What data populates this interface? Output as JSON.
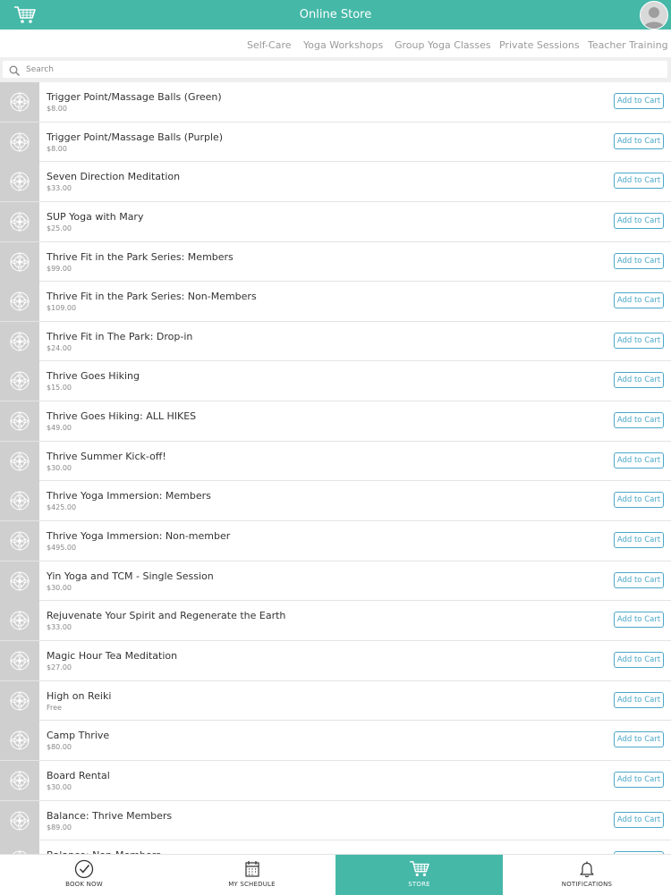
{
  "header": {
    "title": "Online Store"
  },
  "tabs": [
    "Self-Care",
    "Yoga Workshops",
    "Group Yoga Classes",
    "Private Sessions",
    "Teacher Training P"
  ],
  "search": {
    "placeholder": "Search"
  },
  "items": [
    {
      "name": "Trigger Point/Massage Balls (Green)",
      "price": "$8.00",
      "action": "Add to Cart"
    },
    {
      "name": "Trigger Point/Massage Balls (Purple)",
      "price": "$8.00",
      "action": "Add to Cart"
    },
    {
      "name": "Seven Direction Meditation",
      "price": "$33.00",
      "action": "Add to Cart"
    },
    {
      "name": "SUP Yoga with Mary",
      "price": "$25.00",
      "action": "Add to Cart"
    },
    {
      "name": "Thrive Fit in the Park Series: Members",
      "price": "$99.00",
      "action": "Add to Cart"
    },
    {
      "name": "Thrive Fit in the Park Series: Non-Members",
      "price": "$109.00",
      "action": "Add to Cart"
    },
    {
      "name": "Thrive Fit in The Park: Drop-in",
      "price": "$24.00",
      "action": "Add to Cart"
    },
    {
      "name": "Thrive Goes Hiking",
      "price": "$15.00",
      "action": "Add to Cart"
    },
    {
      "name": "Thrive Goes Hiking: ALL HIKES",
      "price": "$49.00",
      "action": "Add to Cart"
    },
    {
      "name": "Thrive Summer Kick-off!",
      "price": "$30.00",
      "action": "Add to Cart"
    },
    {
      "name": "Thrive Yoga Immersion: Members",
      "price": "$425.00",
      "action": "Add to Cart"
    },
    {
      "name": "Thrive Yoga Immersion: Non-member",
      "price": "$495.00",
      "action": "Add to Cart"
    },
    {
      "name": "Yin Yoga and TCM - Single Session",
      "price": "$30.00",
      "action": "Add to Cart"
    },
    {
      "name": "Rejuvenate Your Spirit and Regenerate the Earth",
      "price": "$33.00",
      "action": "Add to Cart"
    },
    {
      "name": "Magic Hour Tea Meditation",
      "price": "$27.00",
      "action": "Add to Cart"
    },
    {
      "name": "High on Reiki",
      "price": "Free",
      "action": "Add to Cart"
    },
    {
      "name": "Camp Thrive",
      "price": "$80.00",
      "action": "Add to Cart"
    },
    {
      "name": "Board Rental",
      "price": "$30.00",
      "action": "Add to Cart"
    },
    {
      "name": "Balance: Thrive Members",
      "price": "$89.00",
      "action": "Add to Cart"
    },
    {
      "name": "Balance: Non-Members",
      "price": "",
      "action": "Add to Cart"
    }
  ],
  "bottom_nav": [
    {
      "label": "BOOK NOW",
      "icon": "check-circle-icon",
      "active": false
    },
    {
      "label": "MY SCHEDULE",
      "icon": "calendar-icon",
      "active": false
    },
    {
      "label": "STORE",
      "icon": "cart-icon",
      "active": true
    },
    {
      "label": "NOTIFICATIONS",
      "icon": "bell-icon",
      "active": false
    }
  ],
  "colors": {
    "accent": "#45b8a8",
    "button_outline": "#4aa7c8"
  }
}
